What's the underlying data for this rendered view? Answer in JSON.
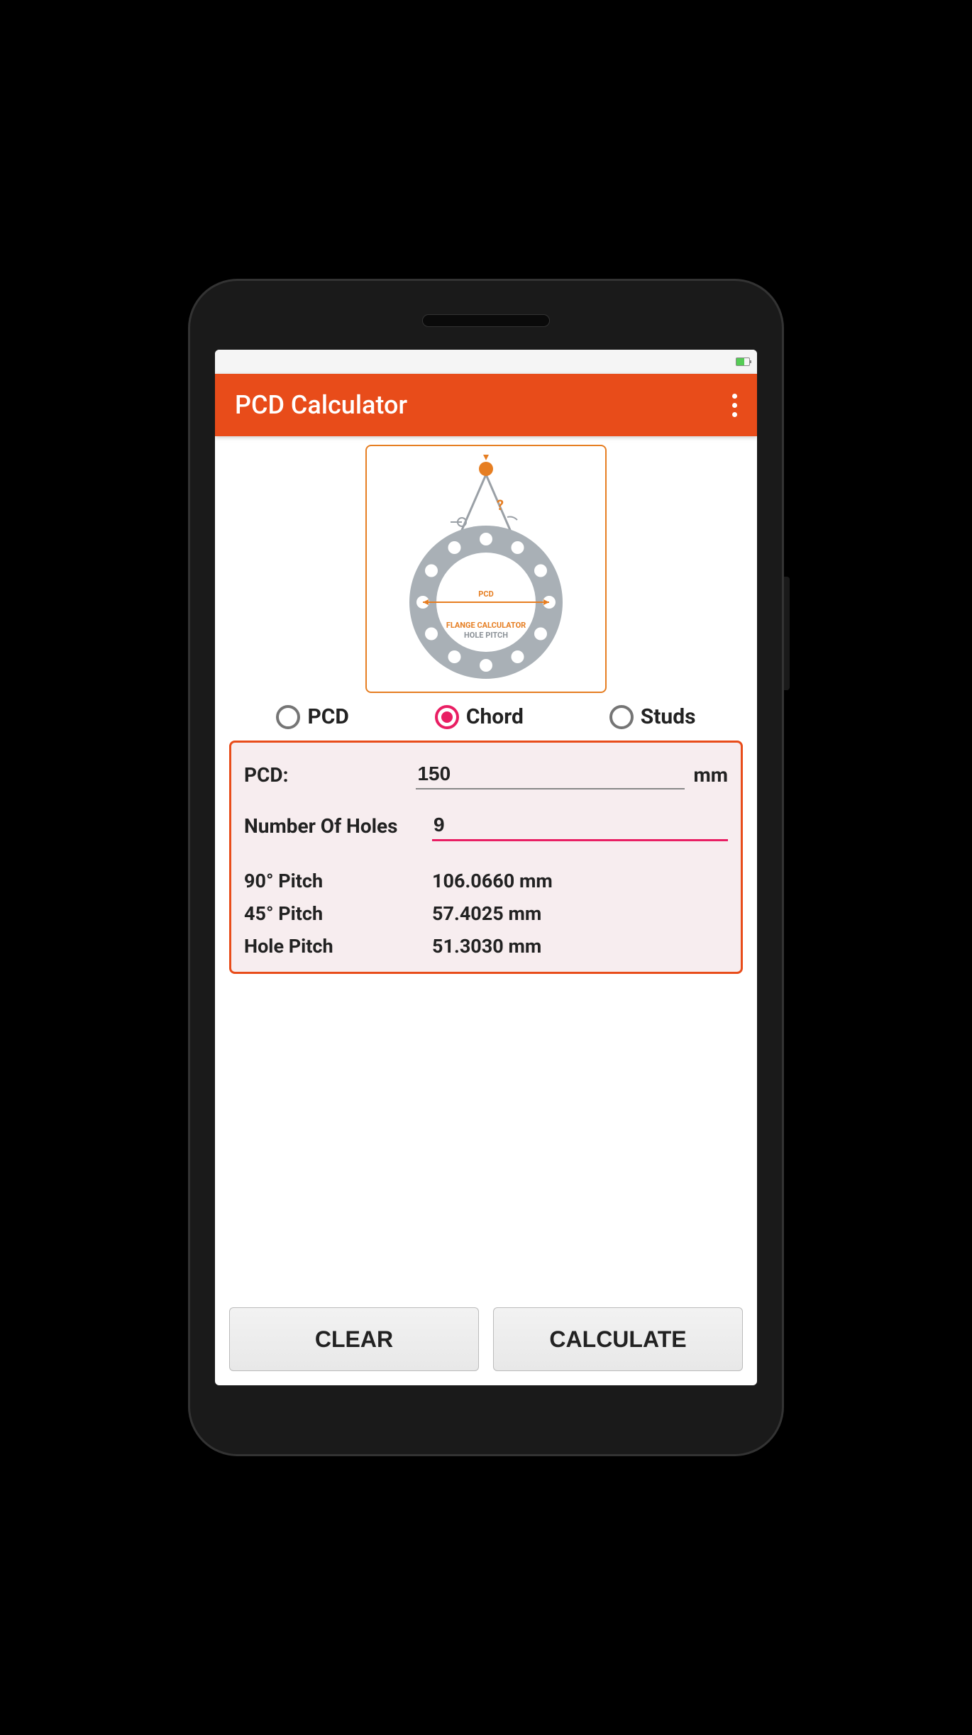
{
  "header": {
    "title": "PCD Calculator"
  },
  "illustration": {
    "pcd_label": "PCD",
    "title_line1": "FLANGE CALCULATOR",
    "title_line2": "HOLE  PITCH"
  },
  "tabs": {
    "items": [
      {
        "label": "PCD",
        "selected": false
      },
      {
        "label": "Chord",
        "selected": true
      },
      {
        "label": "Studs",
        "selected": false
      }
    ]
  },
  "form": {
    "pcd": {
      "label": "PCD:",
      "value": "150",
      "unit": "mm"
    },
    "holes": {
      "label": "Number Of Holes",
      "value": "9"
    },
    "results": [
      {
        "label": "90° Pitch",
        "value": "106.0660 mm"
      },
      {
        "label": "45° Pitch",
        "value": "57.4025 mm"
      },
      {
        "label": "Hole Pitch",
        "value": "51.3030 mm"
      }
    ]
  },
  "buttons": {
    "clear": "CLEAR",
    "calculate": "CALCULATE"
  }
}
